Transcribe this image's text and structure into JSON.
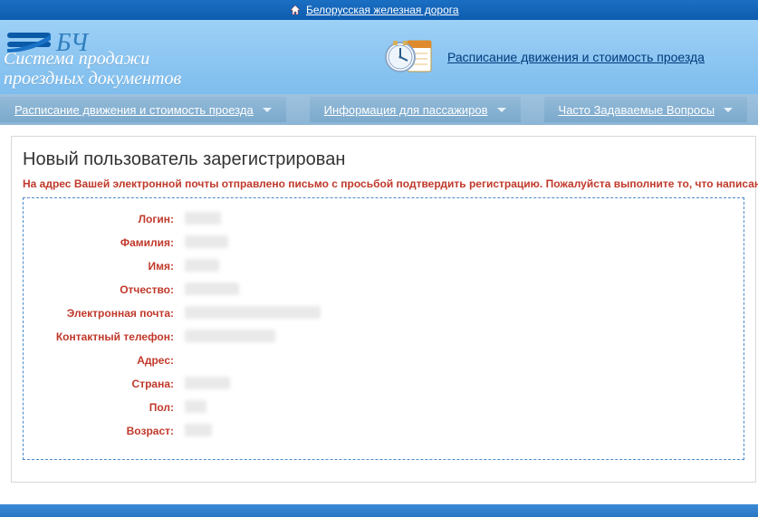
{
  "topbar": {
    "home_link": "Белорусская железная дорога"
  },
  "site_title": {
    "line1": "Система продажи",
    "line2": "проездных документов"
  },
  "big_link": {
    "text": "Расписание движения и стоимость проезда"
  },
  "nav": {
    "items": [
      {
        "label": "Расписание движения и стоимость проезда"
      },
      {
        "label": "Информация для пассажиров"
      },
      {
        "label": "Часто Задаваемые Вопросы"
      }
    ]
  },
  "page": {
    "title": "Новый пользователь зарегистрирован",
    "notice": "На адрес Вашей электронной почты отправлено письмо с просьбой подтвердить регистрацию. Пожалуйста выполните то, что написано в да"
  },
  "fields": {
    "login": "Логин:",
    "lastname": "Фамилия:",
    "firstname": "Имя:",
    "patronymic": "Отчество:",
    "email": "Электронная почта:",
    "phone": "Контактный телефон:",
    "address": "Адрес:",
    "country": "Страна:",
    "sex": "Пол:",
    "age": "Возраст:"
  }
}
